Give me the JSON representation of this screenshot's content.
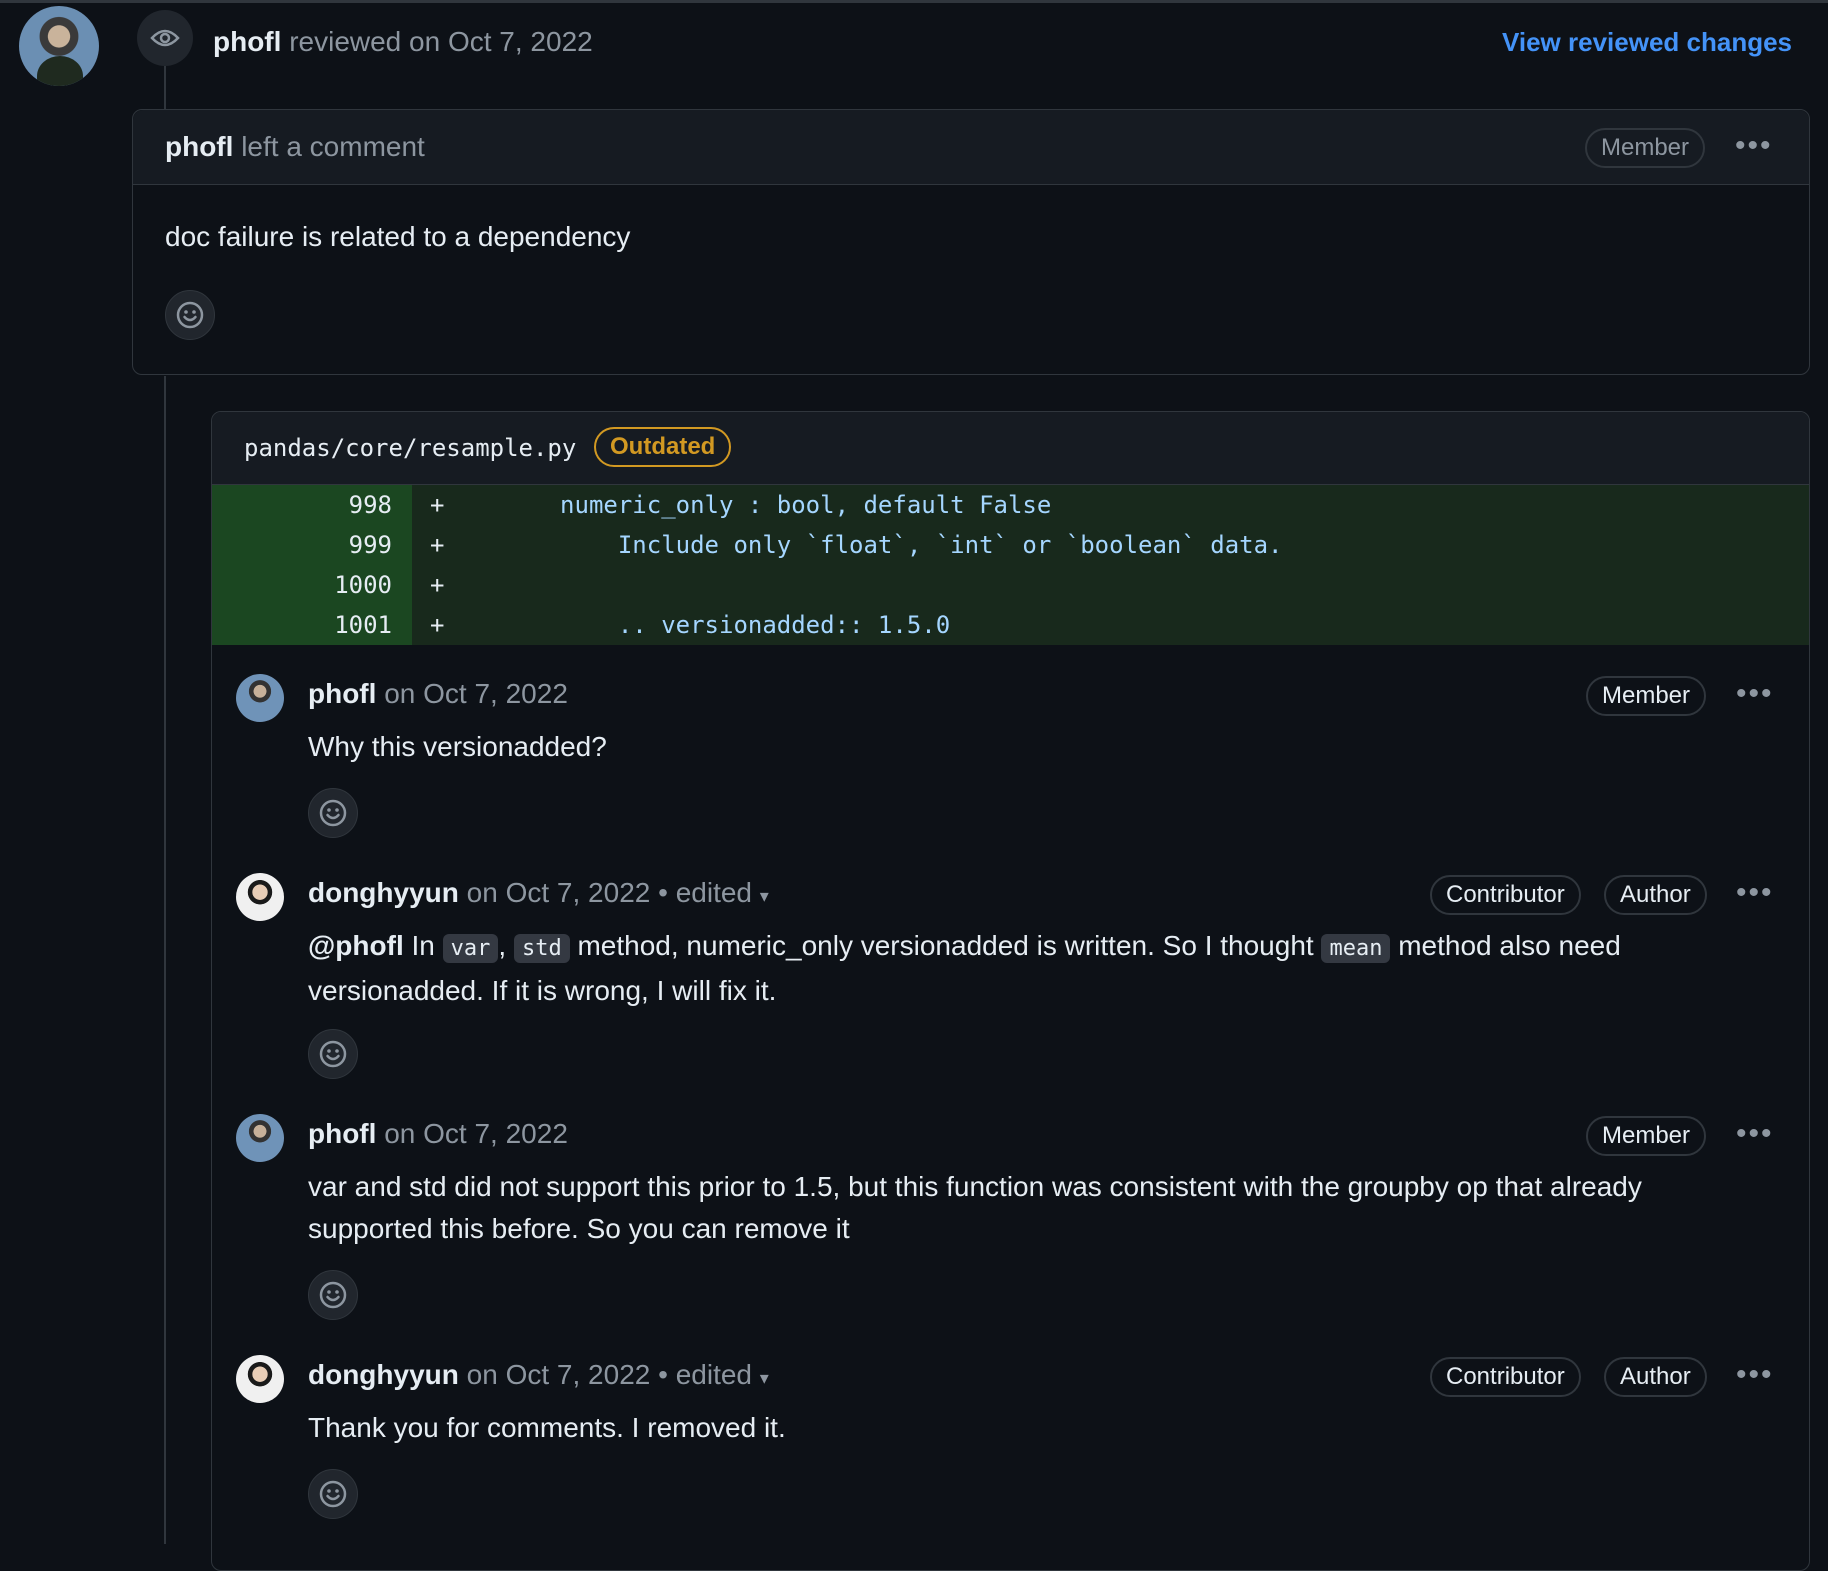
{
  "review": {
    "author": "phofl",
    "action": "reviewed on Oct 7, 2022",
    "link": "View reviewed changes"
  },
  "review_comment": {
    "author": "phofl",
    "action": "left a comment",
    "badge": "Member",
    "body": "doc failure is related to a dependency"
  },
  "file": {
    "path": "pandas/core/resample.py",
    "status": "Outdated",
    "lines": [
      {
        "num": "998",
        "sign": "+",
        "code": "        numeric_only : bool, default False"
      },
      {
        "num": "999",
        "sign": "+",
        "code": "            Include only `float`, `int` or `boolean` data."
      },
      {
        "num": "1000",
        "sign": "+",
        "code": ""
      },
      {
        "num": "1001",
        "sign": "+",
        "code": "            .. versionadded:: 1.5.0"
      }
    ]
  },
  "comments": [
    {
      "author": "phofl",
      "date": "on Oct 7, 2022",
      "edited": "",
      "badges": [
        "Member"
      ],
      "body": "Why this versionadded?"
    },
    {
      "author": "donghyyun",
      "date": "on Oct 7, 2022",
      "edited": "• edited",
      "badges": [
        "Contributor",
        "Author"
      ],
      "body_parts": {
        "mention": "@phofl",
        "t1": " In ",
        "c1": "var",
        "t2": ", ",
        "c2": "std",
        "t3": " method, numeric_only versionadded is written. So I thought ",
        "c3": "mean",
        "t4": " method also need versionadded. If it is wrong, I will fix it."
      }
    },
    {
      "author": "phofl",
      "date": "on Oct 7, 2022",
      "edited": "",
      "badges": [
        "Member"
      ],
      "body": "var and std did not support this prior to 1.5, but this function was consistent with the groupby op that already supported this before. So you can remove it"
    },
    {
      "author": "donghyyun",
      "date": "on Oct 7, 2022",
      "edited": "• edited",
      "badges": [
        "Contributor",
        "Author"
      ],
      "body": "Thank you for comments. I removed it."
    }
  ],
  "icons": {
    "eye": "eye-icon",
    "smiley": "smiley-icon",
    "dots": "kebab-icon",
    "caret": "caret-down-icon"
  },
  "colors": {
    "accent": "#4493f8",
    "outdated": "#d29922",
    "diff_add_bg": "#18291c"
  }
}
